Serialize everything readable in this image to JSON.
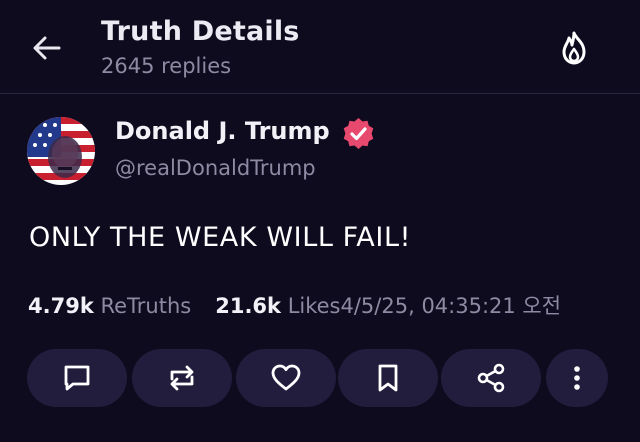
{
  "header": {
    "title": "Truth Details",
    "subtitle": "2645 replies"
  },
  "author": {
    "name": "Donald J. Trump",
    "handle": "@realDonaldTrump"
  },
  "post": {
    "text": "ONLY THE WEAK WILL FAIL!"
  },
  "stats": {
    "retruths_count": "4.79k",
    "retruths_label": "ReTruths",
    "likes_count": "21.6k",
    "likes_label": "Likes",
    "timestamp": "4/5/25, 04:35:21 오전"
  },
  "icons": {
    "back": "arrow-left-icon",
    "trending": "flame-icon",
    "verified": "verified-badge-icon",
    "reply": "comment-icon",
    "retruth": "repost-icon",
    "like": "heart-icon",
    "bookmark": "bookmark-icon",
    "share": "share-icon",
    "more": "more-vertical-icon"
  },
  "colors": {
    "background": "#0e0b1e",
    "button_bg": "#221c3d",
    "muted_text": "#8e8aa3",
    "verified": "#e8496e"
  }
}
